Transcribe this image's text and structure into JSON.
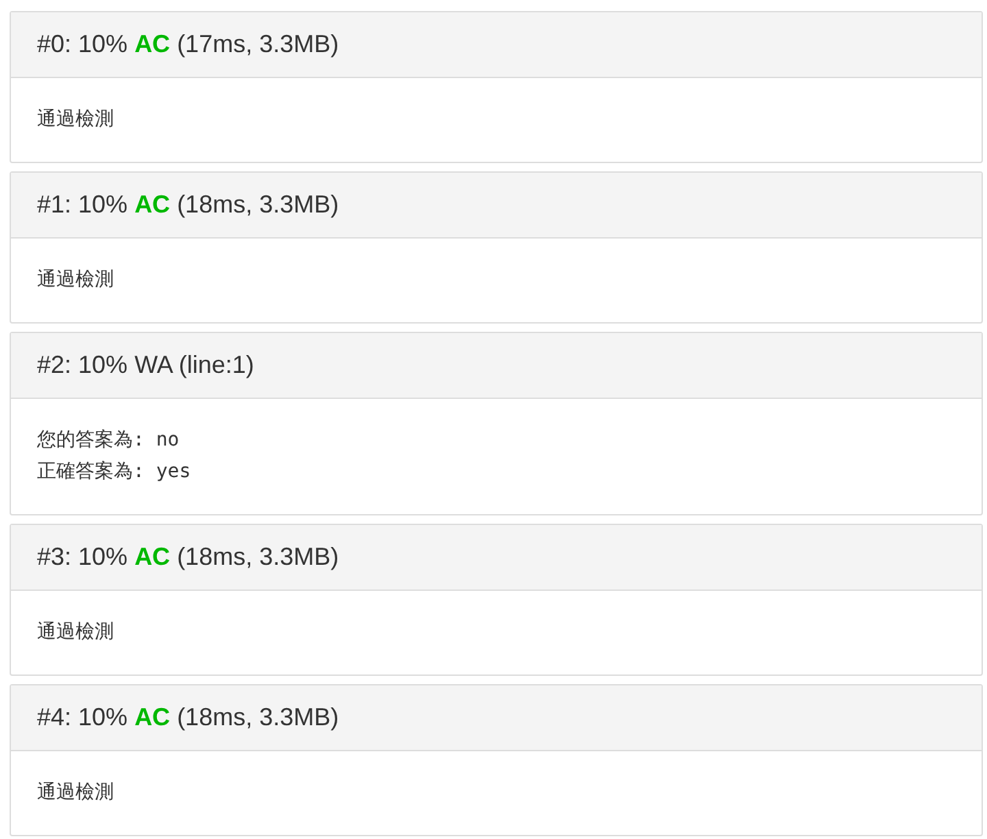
{
  "results": [
    {
      "label": "#0: 10%",
      "kind": "accepted",
      "verdict": "AC",
      "detail": "(17ms, 3.3MB)",
      "message_lines": [
        "通過檢測"
      ]
    },
    {
      "label": "#1: 10%",
      "kind": "accepted",
      "verdict": "AC",
      "detail": "(18ms, 3.3MB)",
      "message_lines": [
        "通過檢測"
      ]
    },
    {
      "label": "#2: 10%",
      "kind": "wrong",
      "verdict": "WA",
      "detail": "(line:1)",
      "message_lines": [
        "您的答案為: no",
        "正確答案為: yes"
      ]
    },
    {
      "label": "#3: 10%",
      "kind": "accepted",
      "verdict": "AC",
      "detail": "(18ms, 3.3MB)",
      "message_lines": [
        "通過檢測"
      ]
    },
    {
      "label": "#4: 10%",
      "kind": "accepted",
      "verdict": "AC",
      "detail": "(18ms, 3.3MB)",
      "message_lines": [
        "通過檢測"
      ]
    }
  ]
}
